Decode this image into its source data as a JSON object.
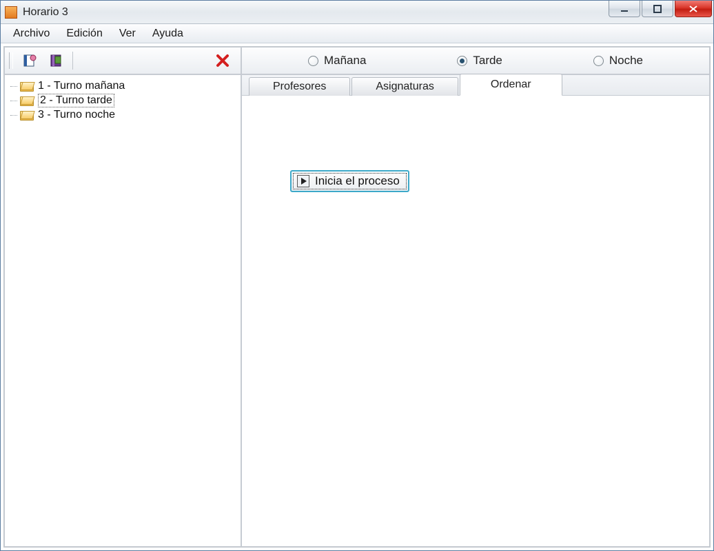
{
  "window": {
    "title": "Horario 3"
  },
  "menu": {
    "file": "Archivo",
    "edit": "Edición",
    "view": "Ver",
    "help": "Ayuda"
  },
  "radios": {
    "morning": "Mañana",
    "afternoon": "Tarde",
    "night": "Noche",
    "selected": "afternoon"
  },
  "tree": {
    "items": [
      {
        "label": "1 - Turno mañana"
      },
      {
        "label": "2 - Turno tarde"
      },
      {
        "label": "3 - Turno noche"
      }
    ],
    "selected_index": 1
  },
  "tabs": {
    "teachers": "Profesores",
    "subjects": "Asignaturas",
    "order": "Ordenar",
    "active": "order"
  },
  "actions": {
    "start_process": "Inicia el proceso"
  }
}
